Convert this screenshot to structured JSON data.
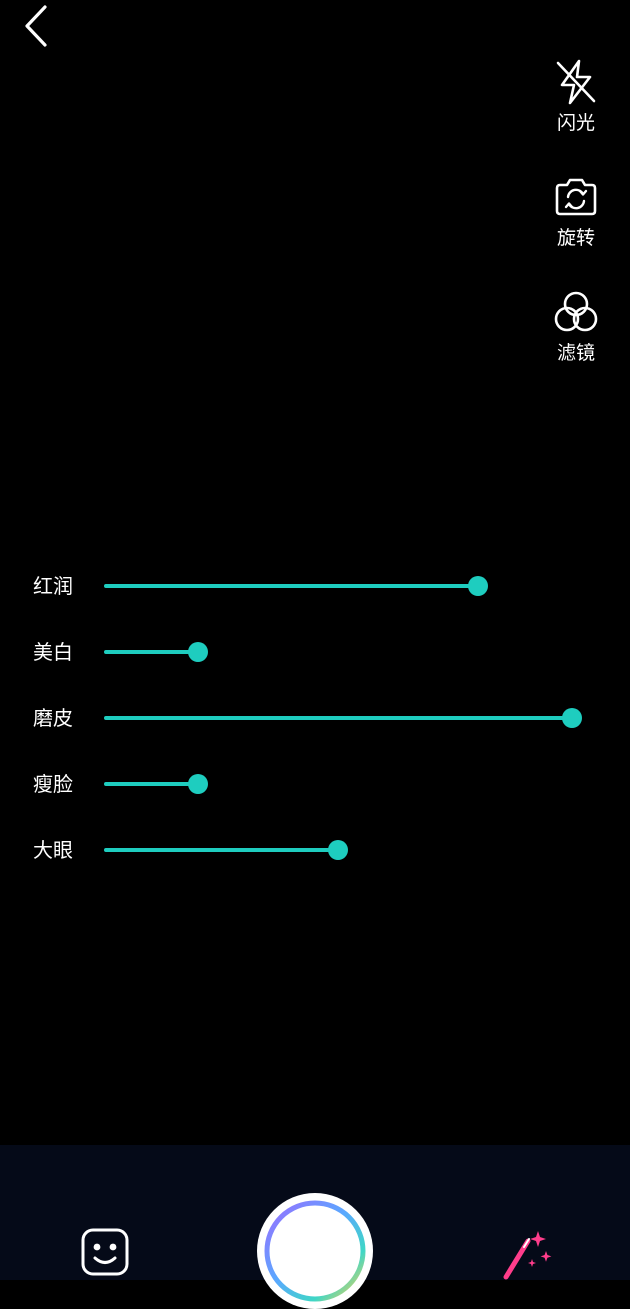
{
  "top_bar": {
    "back_icon": "chevron-left-icon"
  },
  "tools": [
    {
      "id": "flash",
      "label": "闪光",
      "icon": "flash-off-icon"
    },
    {
      "id": "rotate",
      "label": "旋转",
      "icon": "camera-rotate-icon"
    },
    {
      "id": "filter",
      "label": "滤镜",
      "icon": "filter-circles-icon"
    }
  ],
  "beauty_sliders": [
    {
      "label": "红润",
      "value": 0.8
    },
    {
      "label": "美白",
      "value": 0.2
    },
    {
      "label": "磨皮",
      "value": 1.0
    },
    {
      "label": "瘦脸",
      "value": 0.2
    },
    {
      "label": "大眼",
      "value": 0.5
    }
  ],
  "bottom_bar": {
    "sticker_icon": "face-sticker-icon",
    "shutter_icon": "shutter-button",
    "beauty_icon": "magic-wand-icon"
  },
  "colors": {
    "accent": "#1ecdbf",
    "background": "#000000",
    "bottom_bar": "#050a18",
    "wand": "#ff3d8b"
  }
}
